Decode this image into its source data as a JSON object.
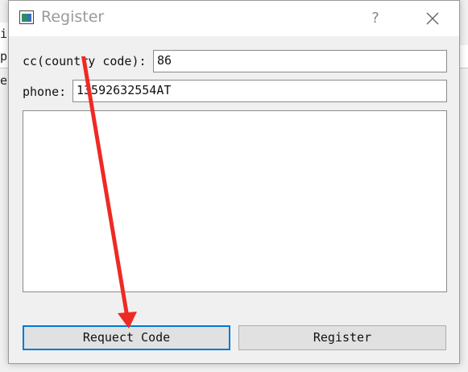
{
  "background": {
    "rows": [
      "in",
      "ph",
      "e"
    ]
  },
  "dialog": {
    "title": "Register",
    "help_label": "?",
    "close_icon": "close-icon",
    "app_icon": "window-app-icon"
  },
  "form": {
    "cc_label": "cc(country code):",
    "cc_value": "86",
    "phone_label": "phone:",
    "phone_value": "13592632554AT",
    "log_text": ""
  },
  "buttons": {
    "request_code": "Requect Code",
    "register": "Register"
  },
  "annotation": {
    "type": "arrow",
    "color": "#ee2a24"
  }
}
